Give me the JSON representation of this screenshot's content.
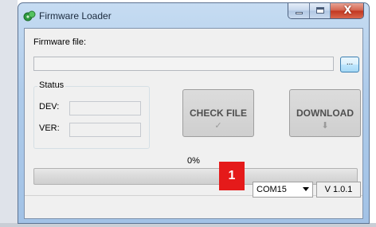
{
  "window": {
    "title": "Firmware Loader",
    "caption_close": "X"
  },
  "firmware": {
    "label": "Firmware file:",
    "value": "",
    "browse_label": "..."
  },
  "status": {
    "title": "Status",
    "dev_label": "DEV:",
    "ver_label": "VER:",
    "dev_value": "",
    "ver_value": ""
  },
  "buttons": {
    "check_file": "CHECK FILE",
    "download": "DOWNLOAD"
  },
  "progress": {
    "percent_text": "0%",
    "fraction": 0
  },
  "statusbar": {
    "badge": "1",
    "port": "COM15",
    "version": "V 1.0.1"
  },
  "colors": {
    "badge": "#e51a1a",
    "close_button": "#c1361f"
  },
  "icons": {
    "app": "green-chip-icon",
    "check": "checkmark-icon",
    "download": "download-arrow-icon"
  }
}
